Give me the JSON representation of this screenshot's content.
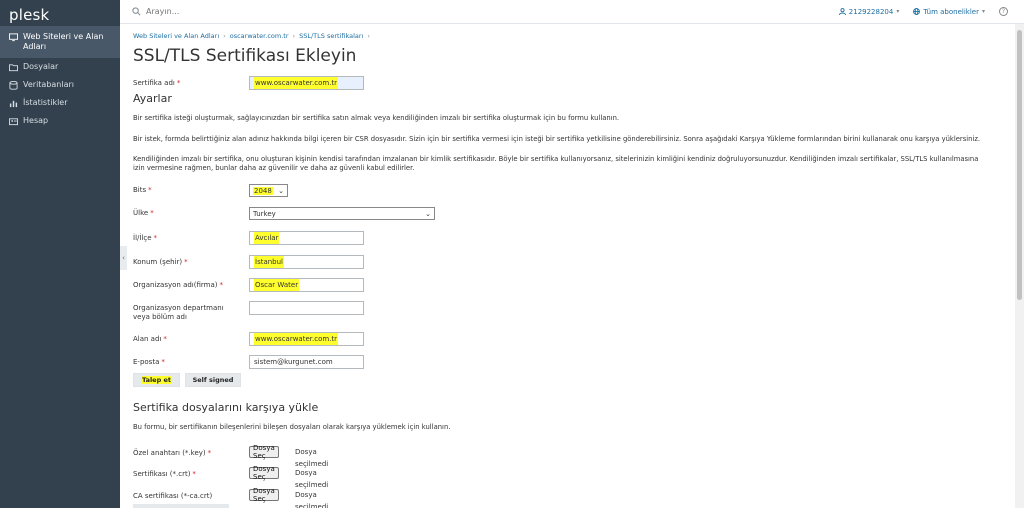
{
  "sidebar": {
    "logo": "plesk",
    "items": [
      {
        "label": "Web Siteleri ve Alan Adları",
        "icon": "monitor-icon"
      },
      {
        "label": "Dosyalar",
        "icon": "folder-icon"
      },
      {
        "label": "Veritabanları",
        "icon": "database-icon"
      },
      {
        "label": "İstatistikler",
        "icon": "stats-icon"
      },
      {
        "label": "Hesap",
        "icon": "account-icon"
      }
    ]
  },
  "topbar": {
    "search_placeholder": "Arayın...",
    "user_id": "2129228204",
    "subscriptions": "Tüm abonelikler"
  },
  "breadcrumb": [
    "Web Siteleri ve Alan Adları",
    "oscarwater.com.tr",
    "SSL/TLS sertifikaları"
  ],
  "page_title": "SSL/TLS Sertifikası Ekleyin",
  "cert_name": {
    "label": "Sertifika adı",
    "value": "www.oscarwater.com.tr"
  },
  "settings": {
    "title": "Ayarlar",
    "desc1": "Bir sertifika isteği oluşturmak, sağlayıcınızdan bir sertifika satın almak veya kendiliğinden imzalı bir sertifika oluşturmak için bu formu kullanın.",
    "desc2": "Bir istek, formda belirttiğiniz alan adınız hakkında bilgi içeren bir CSR dosyasıdır. Sizin için bir sertifika vermesi için isteği bir sertifika yetkilisine gönderebilirsiniz. Sonra aşağıdaki Karşıya Yükleme formlarından birini kullanarak onu karşıya yüklersiniz.",
    "desc3a": "Kendiliğinden imzalı bir sertifika, onu oluşturan kişinin kendisi tarafından imzalanan bir kimlik sertifikasıdır. Böyle bir sertifika kullanıyorsanız, sitelerinizin kimliğini kendiniz doğruluyorsunuzdur. Kendiliğinden imzalı sertifikalar, SSL/TLS kullanılmasına",
    "desc3b": "izin vermesine rağmen, bunlar daha az güvenilir ve daha az güvenli kabul edilirler."
  },
  "fields": {
    "bits": {
      "label": "Bits",
      "value": "2048"
    },
    "country": {
      "label": "Ülke",
      "value": "Turkey"
    },
    "state": {
      "label": "İl/İlçe",
      "value": "Avcılar"
    },
    "city": {
      "label": "Konum (şehir)",
      "value": "İstanbul"
    },
    "org": {
      "label": "Organizasyon adı(firma)",
      "value": "Oscar Water"
    },
    "dept": {
      "label_line1": "Organizasyon departmanı",
      "label_line2": "veya bölüm adı",
      "value": ""
    },
    "domain": {
      "label": "Alan adı",
      "value": "www.oscarwater.com.tr"
    },
    "email": {
      "label": "E-posta",
      "value": "sistem@kurgunet.com"
    }
  },
  "buttons": {
    "request": "Talep et",
    "self_signed": "Self signed"
  },
  "upload": {
    "title": "Sertifika dosyalarını karşıya yükle",
    "desc": "Bu formu, bir sertifikanın bileşenlerini bileşen dosyaları olarak karşıya yüklemek için kullanın.",
    "choose_label": "Dosya Seç",
    "no_file": "Dosya seçilmedi",
    "private_key": "Özel anahtarı (*.key)",
    "certificate": "Sertifikası (*.crt)",
    "ca_certificate": "CA sertifikası (*-ca.crt)"
  },
  "colors": {
    "sidebar_bg": "#33414e",
    "link": "#1c6ea3",
    "highlight": "#ffff2e",
    "required": "#d02424"
  }
}
